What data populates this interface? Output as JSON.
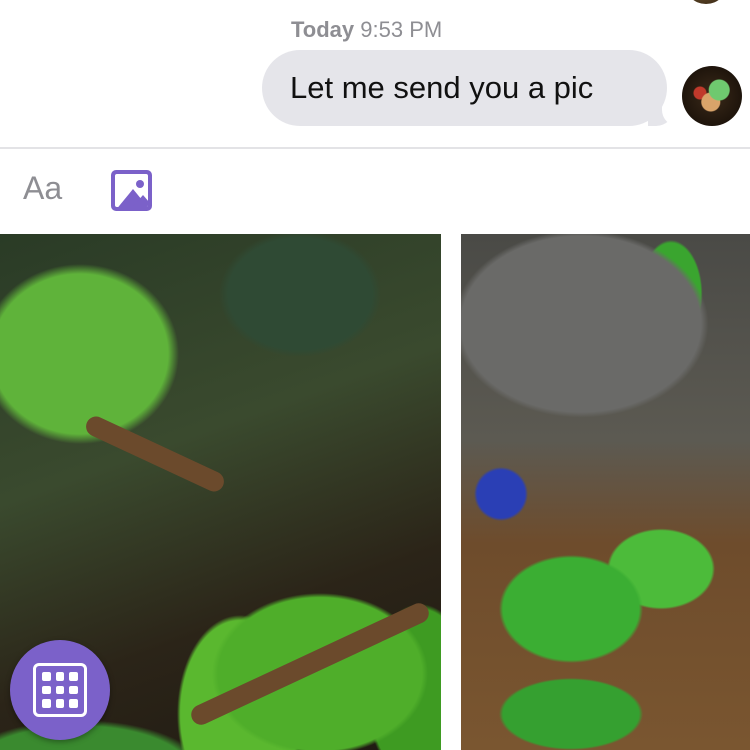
{
  "conversation": {
    "timestamp_day": "Today",
    "timestamp_time": "9:53 PM",
    "outgoing_message": "Let me send you a pic"
  },
  "composer": {
    "text_placeholder": "Aa",
    "image_icon": "image-icon"
  },
  "media_picker": {
    "photos": [
      {
        "icon": "photo-thumbnail"
      },
      {
        "icon": "photo-thumbnail"
      }
    ],
    "grid_toggle_icon": "grid-icon"
  },
  "colors": {
    "accent": "#7b61c9",
    "bubble": "#e5e5ea",
    "timestamp": "#8e8e93"
  }
}
